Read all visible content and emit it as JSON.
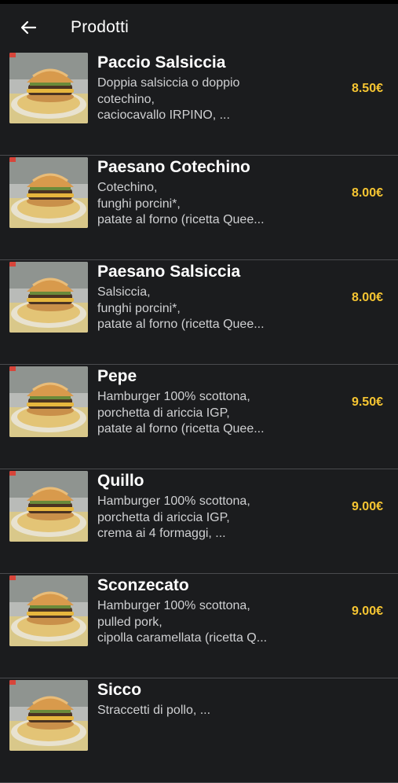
{
  "header": {
    "title": "Prodotti",
    "back_icon": "arrow-left-icon"
  },
  "colors": {
    "background": "#1b1c1e",
    "price": "#f6c532",
    "divider": "#4a4b4e"
  },
  "products": [
    {
      "name": "Paccio Salsiccia",
      "desc": [
        "Doppia salsiccia o doppio",
        "cotechino,",
        "caciocavallo IRPINO, ..."
      ],
      "price": "8.50€"
    },
    {
      "name": "Paesano Cotechino",
      "desc": [
        "Cotechino,",
        "funghi porcini*,",
        "patate al forno (ricetta Quee..."
      ],
      "price": "8.00€"
    },
    {
      "name": "Paesano Salsiccia",
      "desc": [
        "Salsiccia,",
        "funghi porcini*,",
        "patate al forno (ricetta Quee..."
      ],
      "price": "8.00€"
    },
    {
      "name": "Pepe",
      "desc": [
        "Hamburger 100% scottona,",
        "porchetta di ariccia IGP,",
        "patate al forno (ricetta Quee..."
      ],
      "price": "9.50€"
    },
    {
      "name": "Quillo",
      "desc": [
        "Hamburger 100% scottona,",
        "porchetta di ariccia IGP,",
        "crema ai 4 formaggi, ..."
      ],
      "price": "9.00€"
    },
    {
      "name": "Sconzecato",
      "desc": [
        "Hamburger 100% scottona,",
        "pulled pork,",
        "cipolla caramellata (ricetta Q..."
      ],
      "price": "9.00€"
    },
    {
      "name": "Sicco",
      "desc": [
        "Straccetti di pollo, ..."
      ],
      "price": ""
    }
  ]
}
